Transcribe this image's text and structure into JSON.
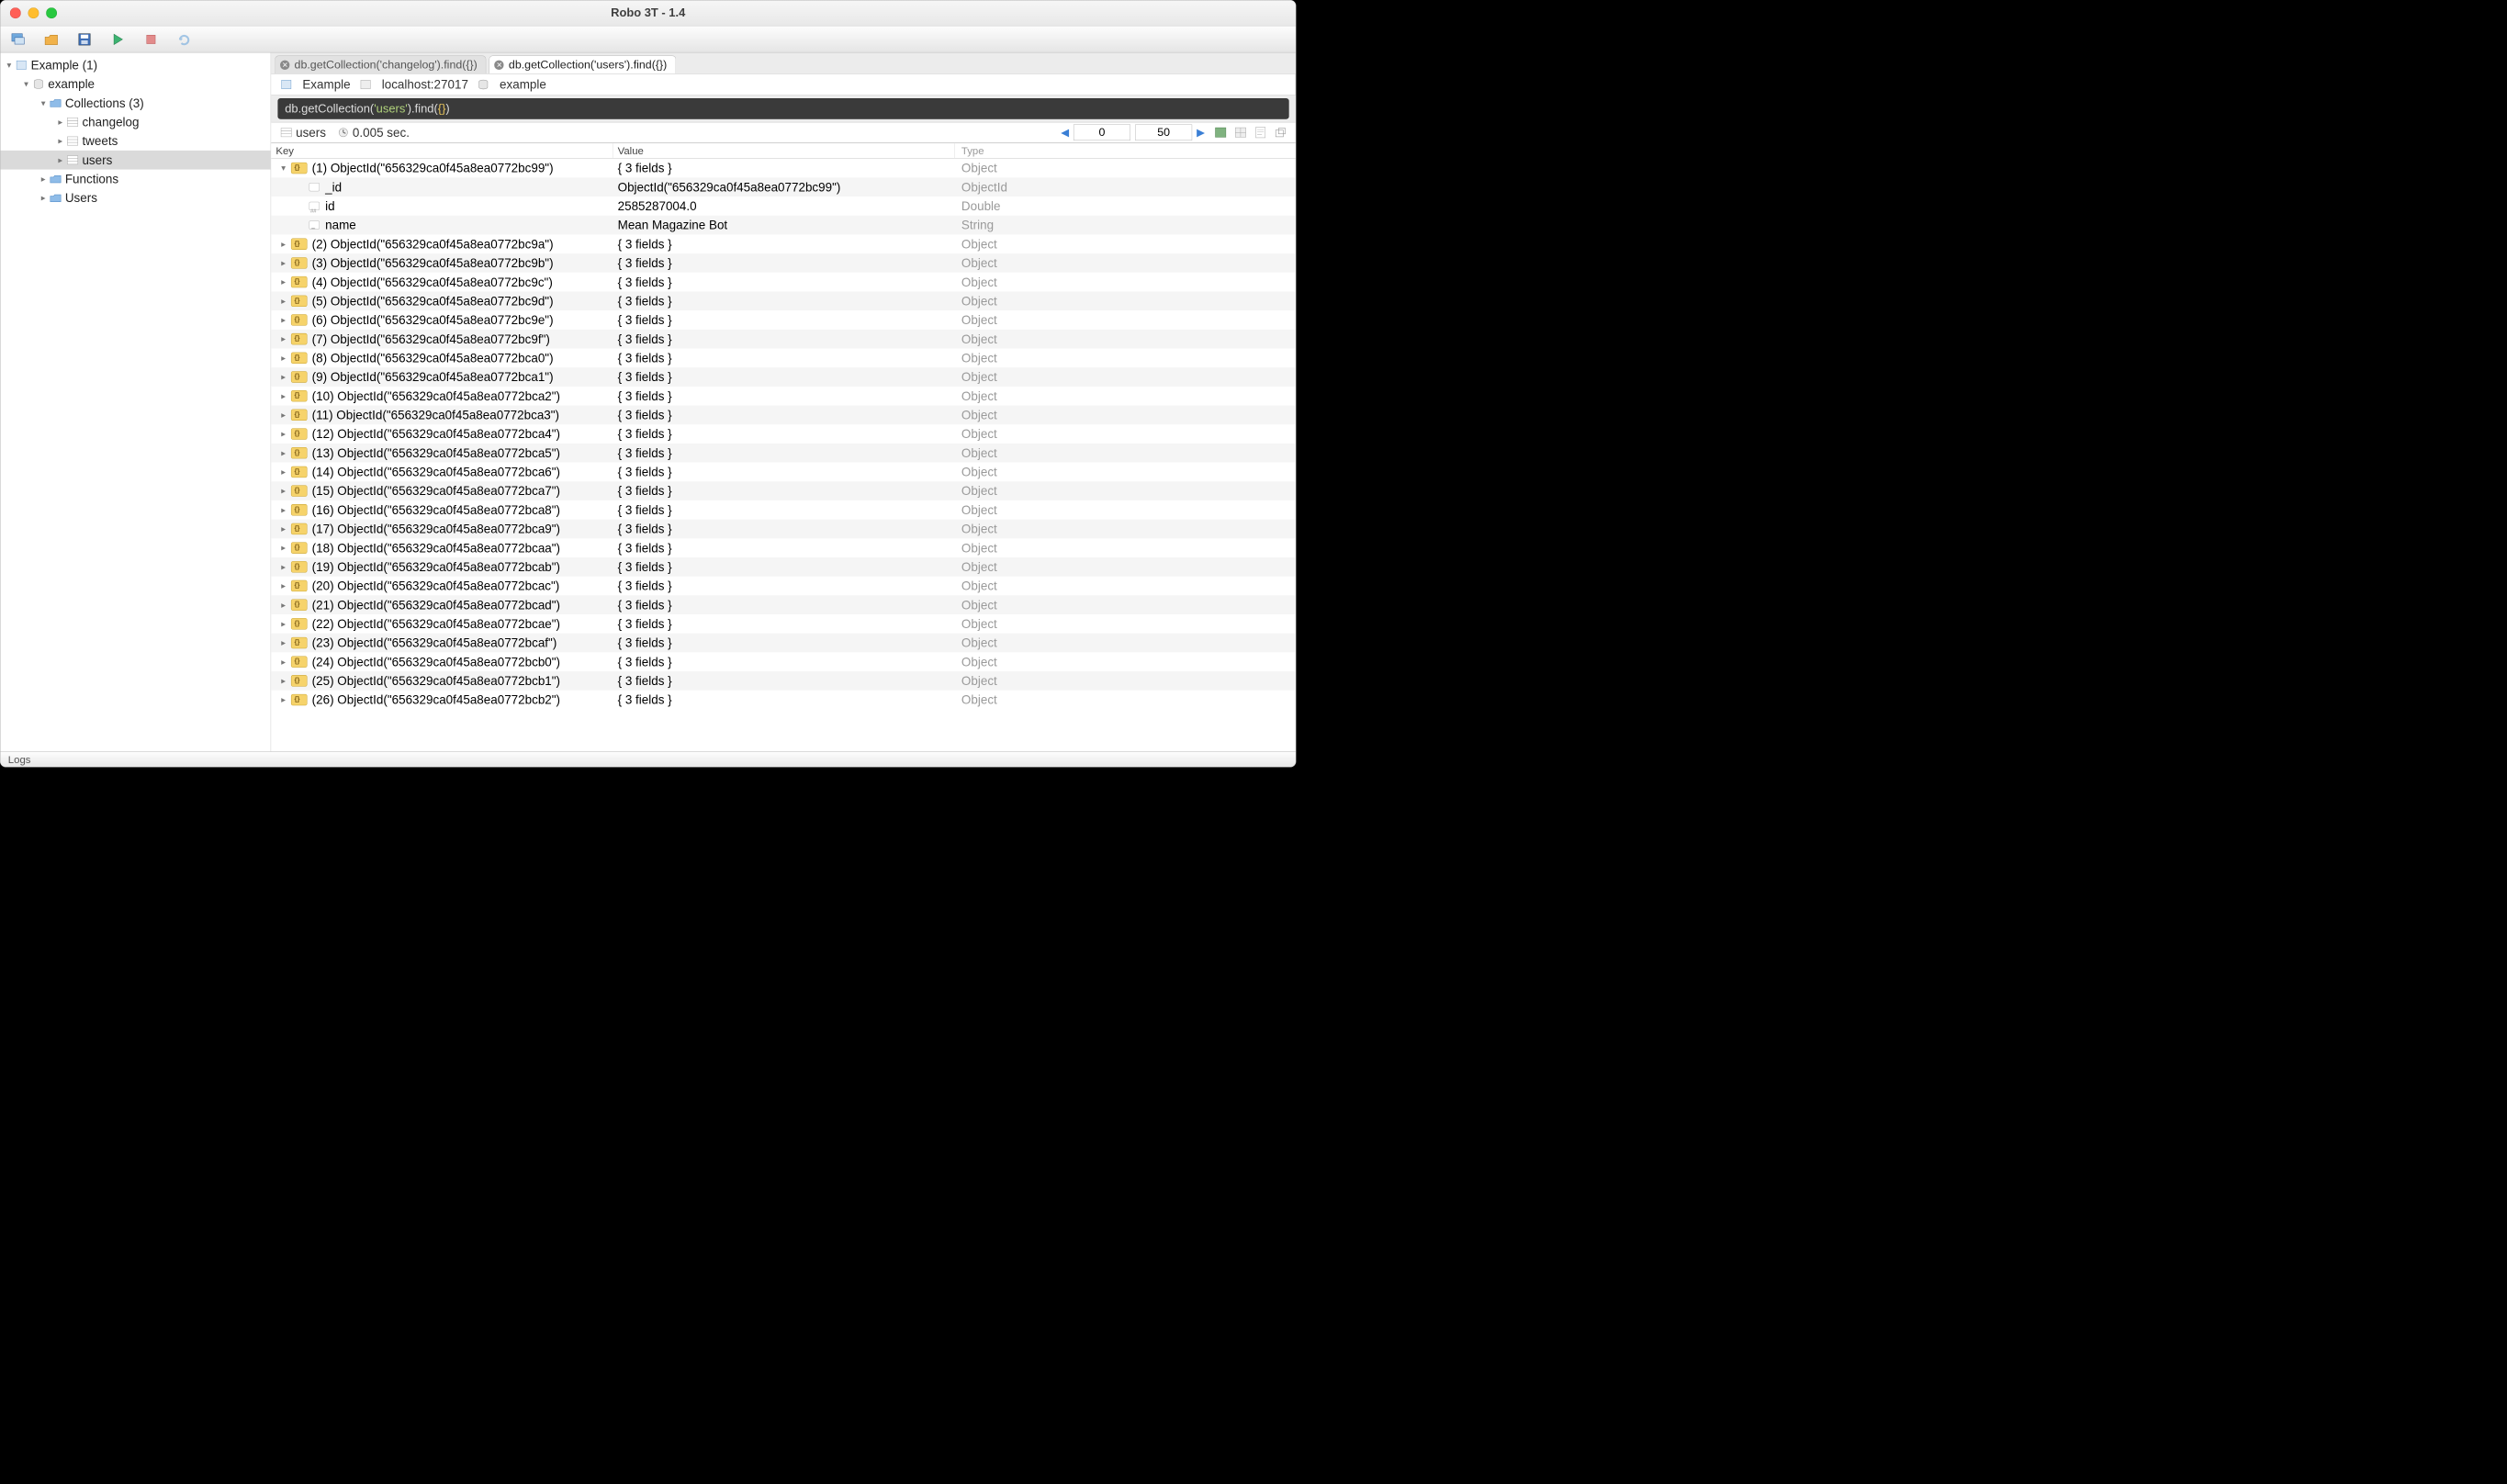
{
  "title": "Robo 3T - 1.4",
  "sidebar": {
    "connection": "Example (1)",
    "database": "example",
    "collections_label": "Collections (3)",
    "collections": [
      "changelog",
      "tweets",
      "users"
    ],
    "functions": "Functions",
    "users_folder": "Users"
  },
  "tabs": [
    {
      "label": "db.getCollection('changelog').find({})",
      "active": false
    },
    {
      "label": "db.getCollection('users').find({})",
      "active": true
    }
  ],
  "breadcrumb": {
    "connection": "Example",
    "host": "localhost:27017",
    "db": "example"
  },
  "query_parts": {
    "prefix": "db.getCollection(",
    "coll": "'users'",
    "mid": ").find(",
    "arg": "{}",
    "suffix": ")"
  },
  "result_meta": {
    "collection": "users",
    "time": "0.005 sec."
  },
  "pagination": {
    "skip": "0",
    "limit": "50"
  },
  "columns": {
    "key": "Key",
    "value": "Value",
    "type": "Type"
  },
  "expanded_fields": [
    {
      "key": "_id",
      "value": "ObjectId(\"656329ca0f45a8ea0772bc99\")",
      "type": "ObjectId",
      "icon": "blank"
    },
    {
      "key": "id",
      "value": "2585287004.0",
      "type": "Double",
      "icon": "num"
    },
    {
      "key": "name",
      "value": "Mean Magazine Bot",
      "type": "String",
      "icon": "str"
    }
  ],
  "rows": [
    {
      "idx": 1,
      "oid": "656329ca0f45a8ea0772bc99",
      "expanded": true
    },
    {
      "idx": 2,
      "oid": "656329ca0f45a8ea0772bc9a"
    },
    {
      "idx": 3,
      "oid": "656329ca0f45a8ea0772bc9b"
    },
    {
      "idx": 4,
      "oid": "656329ca0f45a8ea0772bc9c"
    },
    {
      "idx": 5,
      "oid": "656329ca0f45a8ea0772bc9d"
    },
    {
      "idx": 6,
      "oid": "656329ca0f45a8ea0772bc9e"
    },
    {
      "idx": 7,
      "oid": "656329ca0f45a8ea0772bc9f"
    },
    {
      "idx": 8,
      "oid": "656329ca0f45a8ea0772bca0"
    },
    {
      "idx": 9,
      "oid": "656329ca0f45a8ea0772bca1"
    },
    {
      "idx": 10,
      "oid": "656329ca0f45a8ea0772bca2"
    },
    {
      "idx": 11,
      "oid": "656329ca0f45a8ea0772bca3"
    },
    {
      "idx": 12,
      "oid": "656329ca0f45a8ea0772bca4"
    },
    {
      "idx": 13,
      "oid": "656329ca0f45a8ea0772bca5"
    },
    {
      "idx": 14,
      "oid": "656329ca0f45a8ea0772bca6"
    },
    {
      "idx": 15,
      "oid": "656329ca0f45a8ea0772bca7"
    },
    {
      "idx": 16,
      "oid": "656329ca0f45a8ea0772bca8"
    },
    {
      "idx": 17,
      "oid": "656329ca0f45a8ea0772bca9"
    },
    {
      "idx": 18,
      "oid": "656329ca0f45a8ea0772bcaa"
    },
    {
      "idx": 19,
      "oid": "656329ca0f45a8ea0772bcab"
    },
    {
      "idx": 20,
      "oid": "656329ca0f45a8ea0772bcac"
    },
    {
      "idx": 21,
      "oid": "656329ca0f45a8ea0772bcad"
    },
    {
      "idx": 22,
      "oid": "656329ca0f45a8ea0772bcae"
    },
    {
      "idx": 23,
      "oid": "656329ca0f45a8ea0772bcaf"
    },
    {
      "idx": 24,
      "oid": "656329ca0f45a8ea0772bcb0"
    },
    {
      "idx": 25,
      "oid": "656329ca0f45a8ea0772bcb1"
    },
    {
      "idx": 26,
      "oid": "656329ca0f45a8ea0772bcb2"
    }
  ],
  "row_value": "{ 3 fields }",
  "row_type": "Object",
  "status": {
    "logs": "Logs"
  }
}
